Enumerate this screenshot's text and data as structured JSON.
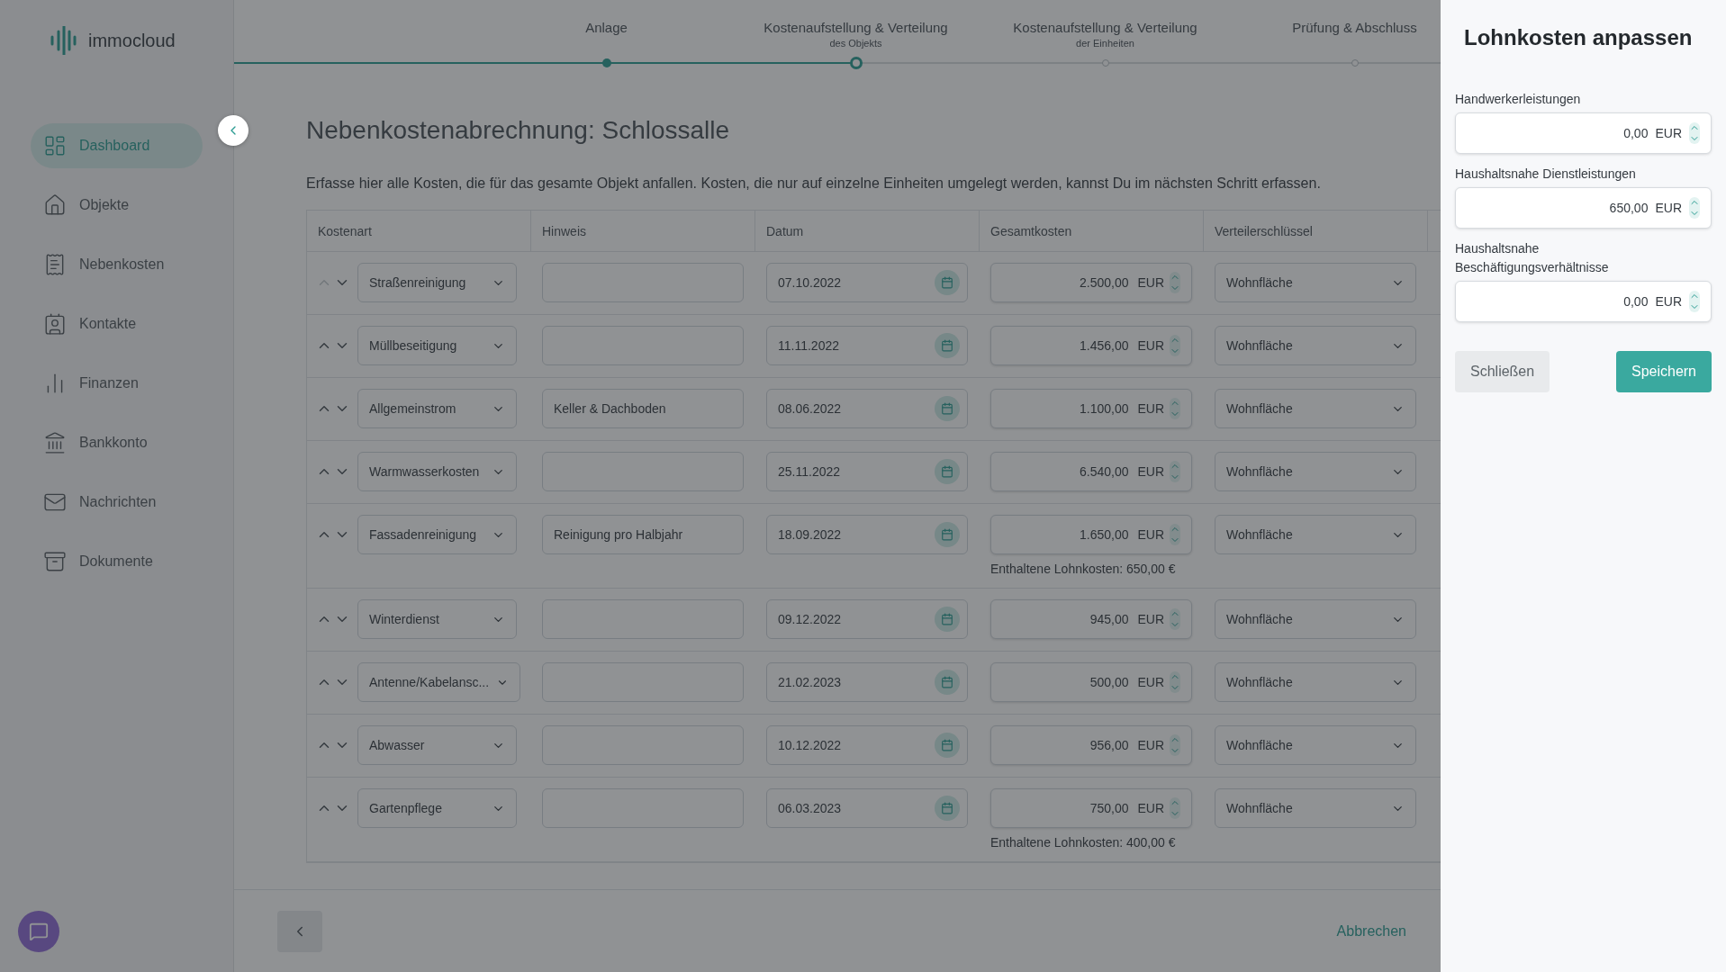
{
  "brand": {
    "name": "immocloud"
  },
  "sidebar": {
    "items": [
      {
        "label": "Dashboard",
        "selected": true
      },
      {
        "label": "Objekte",
        "selected": false
      },
      {
        "label": "Nebenkosten",
        "selected": false
      },
      {
        "label": "Kontakte",
        "selected": false
      },
      {
        "label": "Finanzen",
        "selected": false
      },
      {
        "label": "Bankkonto",
        "selected": false
      },
      {
        "label": "Nachrichten",
        "selected": false
      },
      {
        "label": "Dokumente",
        "selected": false
      }
    ]
  },
  "stepper": {
    "steps": [
      {
        "label": "Anlage",
        "completed": true,
        "selected": false
      },
      {
        "label": "Kostenaufstellung & Verteilung",
        "sublabel": "des Objekts",
        "completed": false,
        "selected": true
      },
      {
        "label": "Kostenaufstellung & Verteilung",
        "sublabel": "der Einheiten",
        "completed": false,
        "selected": false
      },
      {
        "label": "Prüfung & Abschluss",
        "completed": false,
        "selected": false
      }
    ]
  },
  "page": {
    "title": "Nebenkostenabrechnung: Schlossalle",
    "description": "Erfasse hier alle Kosten, die für das gesamte Objekt anfallen. Kosten, die nur auf einzelne Einheiten umgelegt werden, kannst Du im nächsten Schritt erfassen."
  },
  "table": {
    "columns": [
      "Kostenart",
      "Hinweis",
      "Datum",
      "Gesamtkosten",
      "Verteilerschlüssel"
    ],
    "rows": [
      {
        "cost_type": "Straßenreinigung",
        "date": "07.10.2022",
        "total": "2.500,00",
        "currency": "EUR",
        "distribution_key": "Wohnfläche",
        "move_up_disabled": true
      },
      {
        "cost_type": "Müllbeseitigung",
        "date": "11.11.2022",
        "total": "1.456,00",
        "currency": "EUR",
        "distribution_key": "Wohnfläche",
        "move_up_disabled": false
      },
      {
        "cost_type": "Allgemeinstrom",
        "note": "Keller & Dachboden",
        "date": "08.06.2022",
        "total": "1.100,00",
        "currency": "EUR",
        "distribution_key": "Wohnfläche",
        "move_up_disabled": false
      },
      {
        "cost_type": "Warmwasserkosten",
        "date": "25.11.2022",
        "total": "6.540,00",
        "currency": "EUR",
        "distribution_key": "Wohnfläche",
        "move_up_disabled": false
      },
      {
        "cost_type": "Fassadenreinigung",
        "note": "Reinigung pro Halbjahr",
        "date": "18.09.2022",
        "total": "1.650,00",
        "currency": "EUR",
        "distribution_key": "Wohnfläche",
        "move_up_disabled": false,
        "wage_costs_note": "Enthaltene Lohnkosten: 650,00 €"
      },
      {
        "cost_type": "Winterdienst",
        "date": "09.12.2022",
        "total": "945,00",
        "currency": "EUR",
        "distribution_key": "Wohnfläche",
        "move_up_disabled": false
      },
      {
        "cost_type": "Antenne/Kabelansc...",
        "date": "21.02.2023",
        "total": "500,00",
        "currency": "EUR",
        "distribution_key": "Wohnfläche",
        "move_up_disabled": false
      },
      {
        "cost_type": "Abwasser",
        "date": "10.12.2022",
        "total": "956,00",
        "currency": "EUR",
        "distribution_key": "Wohnfläche",
        "move_up_disabled": false
      },
      {
        "cost_type": "Gartenpflege",
        "date": "06.03.2023",
        "total": "750,00",
        "currency": "EUR",
        "distribution_key": "Wohnfläche",
        "move_up_disabled": false,
        "wage_costs_note": "Enthaltene Lohnkosten: 400,00 €"
      }
    ]
  },
  "footer": {
    "cancel": "Abbrechen"
  },
  "drawer": {
    "title": "Lohnkosten anpassen",
    "fields": [
      {
        "label": "Handwerkerleistungen",
        "value": "0,00",
        "currency": "EUR"
      },
      {
        "label": "Haushaltsnahe Dienstleistungen",
        "value": "650,00",
        "currency": "EUR"
      },
      {
        "label": "Haushaltsnahe Beschäftigungsverhältnisse",
        "value": "0,00",
        "currency": "EUR"
      }
    ],
    "buttons": [
      {
        "label": "Schließen",
        "kind": "secondary"
      },
      {
        "label": "Speichern",
        "kind": "primary"
      }
    ]
  }
}
